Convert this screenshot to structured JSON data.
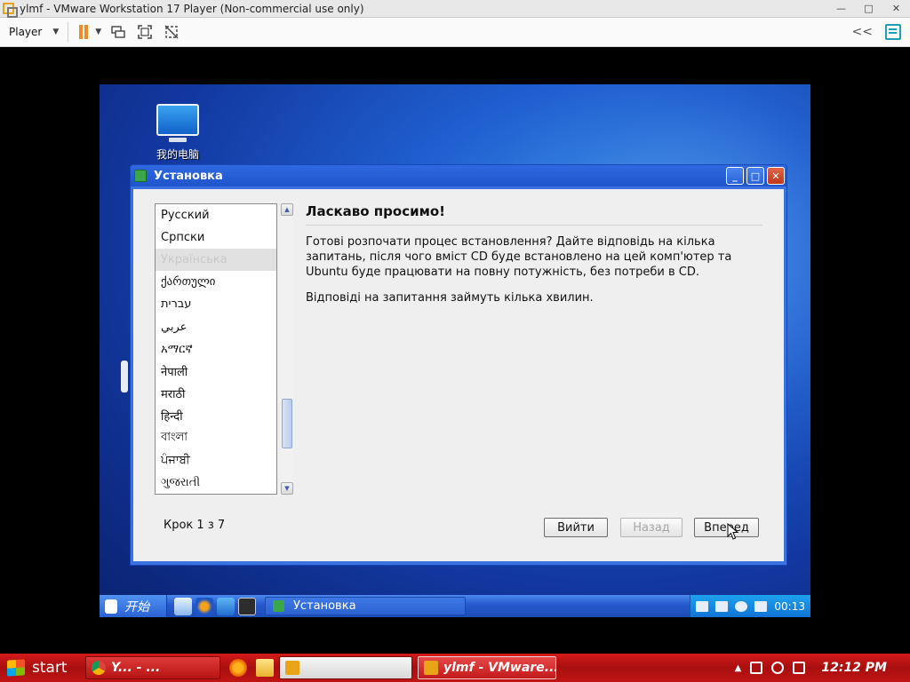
{
  "vmware": {
    "window_title": "ylmf - VMware Workstation 17 Player (Non-commercial use only)",
    "minimize": "—",
    "maximize": "□",
    "close": "✕",
    "player_menu": "Player",
    "collapse": "<<"
  },
  "guest": {
    "desktop_icon_label": "我的电脑",
    "installer": {
      "title": "Установка",
      "languages": [
        "Русский",
        "Српски",
        "Українська",
        "ქართული",
        "עברית",
        "عربي",
        "አማርኛ",
        "नेपाली",
        "मराठी",
        "हिन्दी",
        "বাংলা",
        "ਪੰਜਾਬੀ",
        "ગુજરાતી"
      ],
      "selected_language_index": 2,
      "heading": "Ласкаво просимо!",
      "paragraph1": "Готові розпочати процес встановлення? Дайте відповідь на кілька запитань, після чого вміст CD буде встановлено на цей комп'ютер та Ubuntu буде працювати на повну потужність, без потреби в CD.",
      "paragraph2": "Відповіді на запитання займуть кілька хвилин.",
      "step": "Крок 1 з 7",
      "btn_exit": "Вийти",
      "btn_back": "Назад",
      "btn_next": "Вперед"
    },
    "taskbar": {
      "start_label": "开始",
      "task_label": "Установка",
      "clock": "00:13"
    }
  },
  "host_taskbar": {
    "start_label": "start",
    "task1": "Y... - ...",
    "task3": "ylmf - VMware...",
    "clock": "12:12 PM"
  },
  "colors": {
    "host_taskbar": "#c01414",
    "guest_desktop": "#1f5fcf",
    "installer_title": "#2f68e0"
  }
}
